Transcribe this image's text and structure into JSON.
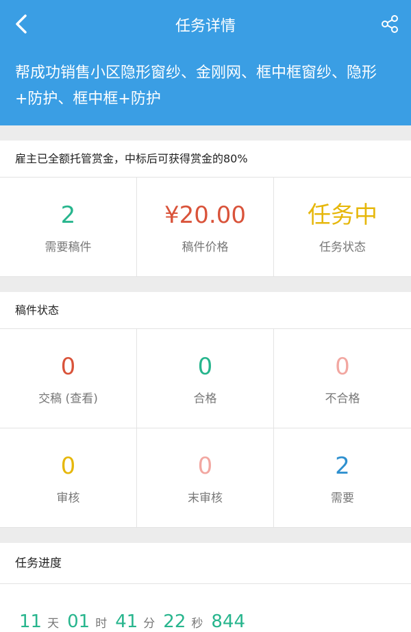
{
  "header": {
    "title": "任务详情",
    "task_title": "帮成功销售小区隐形窗纱、金刚网、框中框窗纱、隐形+防护、框中框+防护"
  },
  "reward_notice": "雇主已全额托管赏金，中标后可获得赏金的80%",
  "summary": [
    {
      "value": "2",
      "label": "需要稿件",
      "color": "#27b58d"
    },
    {
      "value": "¥20.00",
      "label": "稿件价格",
      "color": "#d9533a"
    },
    {
      "value": "任务中",
      "label": "任务状态",
      "color": "#e6b70b"
    }
  ],
  "draft_status": {
    "title": "稿件状态",
    "items": [
      {
        "value": "0",
        "label": "交稿 (查看)",
        "color": "#d9533a"
      },
      {
        "value": "0",
        "label": "合格",
        "color": "#27b58d"
      },
      {
        "value": "0",
        "label": "不合格",
        "color": "#f2a7a1"
      },
      {
        "value": "0",
        "label": "审核",
        "color": "#e6b70b"
      },
      {
        "value": "0",
        "label": "末审核",
        "color": "#f2a7a1"
      },
      {
        "value": "2",
        "label": "需要",
        "color": "#2e90cf"
      }
    ]
  },
  "progress": {
    "title": "任务进度",
    "countdown": {
      "days": "11",
      "days_unit": "天",
      "hours": "01",
      "hours_unit": "时",
      "minutes": "41",
      "minutes_unit": "分",
      "seconds": "22",
      "seconds_unit": "秒",
      "ms": "844"
    }
  },
  "icons": {
    "back": "chevron-left-icon",
    "share": "share-icon"
  }
}
